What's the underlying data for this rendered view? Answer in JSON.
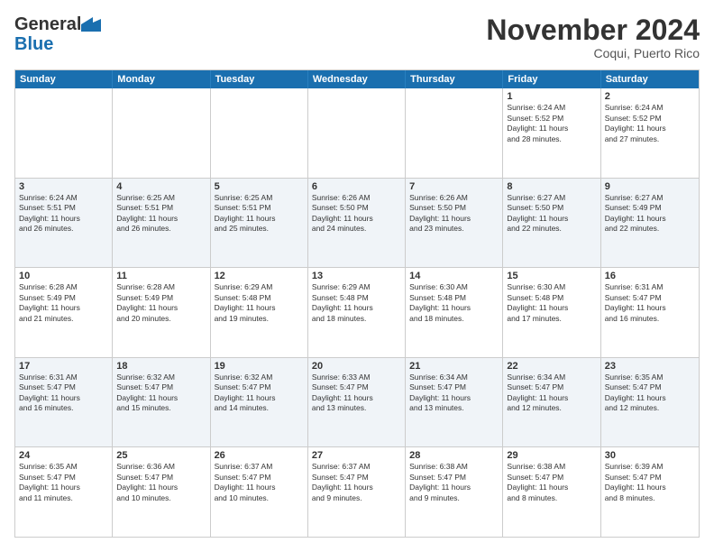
{
  "logo": {
    "line1": "General",
    "line2": "Blue"
  },
  "title": "November 2024",
  "subtitle": "Coqui, Puerto Rico",
  "weekdays": [
    "Sunday",
    "Monday",
    "Tuesday",
    "Wednesday",
    "Thursday",
    "Friday",
    "Saturday"
  ],
  "rows": [
    {
      "alt": false,
      "cells": [
        {
          "day": "",
          "lines": []
        },
        {
          "day": "",
          "lines": []
        },
        {
          "day": "",
          "lines": []
        },
        {
          "day": "",
          "lines": []
        },
        {
          "day": "",
          "lines": []
        },
        {
          "day": "1",
          "lines": [
            "Sunrise: 6:24 AM",
            "Sunset: 5:52 PM",
            "Daylight: 11 hours",
            "and 28 minutes."
          ]
        },
        {
          "day": "2",
          "lines": [
            "Sunrise: 6:24 AM",
            "Sunset: 5:52 PM",
            "Daylight: 11 hours",
            "and 27 minutes."
          ]
        }
      ]
    },
    {
      "alt": true,
      "cells": [
        {
          "day": "3",
          "lines": [
            "Sunrise: 6:24 AM",
            "Sunset: 5:51 PM",
            "Daylight: 11 hours",
            "and 26 minutes."
          ]
        },
        {
          "day": "4",
          "lines": [
            "Sunrise: 6:25 AM",
            "Sunset: 5:51 PM",
            "Daylight: 11 hours",
            "and 26 minutes."
          ]
        },
        {
          "day": "5",
          "lines": [
            "Sunrise: 6:25 AM",
            "Sunset: 5:51 PM",
            "Daylight: 11 hours",
            "and 25 minutes."
          ]
        },
        {
          "day": "6",
          "lines": [
            "Sunrise: 6:26 AM",
            "Sunset: 5:50 PM",
            "Daylight: 11 hours",
            "and 24 minutes."
          ]
        },
        {
          "day": "7",
          "lines": [
            "Sunrise: 6:26 AM",
            "Sunset: 5:50 PM",
            "Daylight: 11 hours",
            "and 23 minutes."
          ]
        },
        {
          "day": "8",
          "lines": [
            "Sunrise: 6:27 AM",
            "Sunset: 5:50 PM",
            "Daylight: 11 hours",
            "and 22 minutes."
          ]
        },
        {
          "day": "9",
          "lines": [
            "Sunrise: 6:27 AM",
            "Sunset: 5:49 PM",
            "Daylight: 11 hours",
            "and 22 minutes."
          ]
        }
      ]
    },
    {
      "alt": false,
      "cells": [
        {
          "day": "10",
          "lines": [
            "Sunrise: 6:28 AM",
            "Sunset: 5:49 PM",
            "Daylight: 11 hours",
            "and 21 minutes."
          ]
        },
        {
          "day": "11",
          "lines": [
            "Sunrise: 6:28 AM",
            "Sunset: 5:49 PM",
            "Daylight: 11 hours",
            "and 20 minutes."
          ]
        },
        {
          "day": "12",
          "lines": [
            "Sunrise: 6:29 AM",
            "Sunset: 5:48 PM",
            "Daylight: 11 hours",
            "and 19 minutes."
          ]
        },
        {
          "day": "13",
          "lines": [
            "Sunrise: 6:29 AM",
            "Sunset: 5:48 PM",
            "Daylight: 11 hours",
            "and 18 minutes."
          ]
        },
        {
          "day": "14",
          "lines": [
            "Sunrise: 6:30 AM",
            "Sunset: 5:48 PM",
            "Daylight: 11 hours",
            "and 18 minutes."
          ]
        },
        {
          "day": "15",
          "lines": [
            "Sunrise: 6:30 AM",
            "Sunset: 5:48 PM",
            "Daylight: 11 hours",
            "and 17 minutes."
          ]
        },
        {
          "day": "16",
          "lines": [
            "Sunrise: 6:31 AM",
            "Sunset: 5:47 PM",
            "Daylight: 11 hours",
            "and 16 minutes."
          ]
        }
      ]
    },
    {
      "alt": true,
      "cells": [
        {
          "day": "17",
          "lines": [
            "Sunrise: 6:31 AM",
            "Sunset: 5:47 PM",
            "Daylight: 11 hours",
            "and 16 minutes."
          ]
        },
        {
          "day": "18",
          "lines": [
            "Sunrise: 6:32 AM",
            "Sunset: 5:47 PM",
            "Daylight: 11 hours",
            "and 15 minutes."
          ]
        },
        {
          "day": "19",
          "lines": [
            "Sunrise: 6:32 AM",
            "Sunset: 5:47 PM",
            "Daylight: 11 hours",
            "and 14 minutes."
          ]
        },
        {
          "day": "20",
          "lines": [
            "Sunrise: 6:33 AM",
            "Sunset: 5:47 PM",
            "Daylight: 11 hours",
            "and 13 minutes."
          ]
        },
        {
          "day": "21",
          "lines": [
            "Sunrise: 6:34 AM",
            "Sunset: 5:47 PM",
            "Daylight: 11 hours",
            "and 13 minutes."
          ]
        },
        {
          "day": "22",
          "lines": [
            "Sunrise: 6:34 AM",
            "Sunset: 5:47 PM",
            "Daylight: 11 hours",
            "and 12 minutes."
          ]
        },
        {
          "day": "23",
          "lines": [
            "Sunrise: 6:35 AM",
            "Sunset: 5:47 PM",
            "Daylight: 11 hours",
            "and 12 minutes."
          ]
        }
      ]
    },
    {
      "alt": false,
      "cells": [
        {
          "day": "24",
          "lines": [
            "Sunrise: 6:35 AM",
            "Sunset: 5:47 PM",
            "Daylight: 11 hours",
            "and 11 minutes."
          ]
        },
        {
          "day": "25",
          "lines": [
            "Sunrise: 6:36 AM",
            "Sunset: 5:47 PM",
            "Daylight: 11 hours",
            "and 10 minutes."
          ]
        },
        {
          "day": "26",
          "lines": [
            "Sunrise: 6:37 AM",
            "Sunset: 5:47 PM",
            "Daylight: 11 hours",
            "and 10 minutes."
          ]
        },
        {
          "day": "27",
          "lines": [
            "Sunrise: 6:37 AM",
            "Sunset: 5:47 PM",
            "Daylight: 11 hours",
            "and 9 minutes."
          ]
        },
        {
          "day": "28",
          "lines": [
            "Sunrise: 6:38 AM",
            "Sunset: 5:47 PM",
            "Daylight: 11 hours",
            "and 9 minutes."
          ]
        },
        {
          "day": "29",
          "lines": [
            "Sunrise: 6:38 AM",
            "Sunset: 5:47 PM",
            "Daylight: 11 hours",
            "and 8 minutes."
          ]
        },
        {
          "day": "30",
          "lines": [
            "Sunrise: 6:39 AM",
            "Sunset: 5:47 PM",
            "Daylight: 11 hours",
            "and 8 minutes."
          ]
        }
      ]
    }
  ]
}
